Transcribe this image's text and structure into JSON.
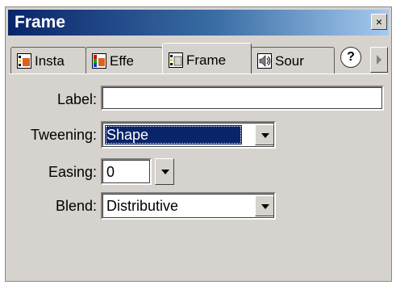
{
  "window": {
    "title": "Frame",
    "close_glyph": "×"
  },
  "tabs": [
    {
      "label": "Insta",
      "icon": "instance-icon"
    },
    {
      "label": "Effe",
      "icon": "effect-icon"
    },
    {
      "label": "Frame",
      "icon": "frame-icon",
      "active": true
    },
    {
      "label": "Sour",
      "icon": "sound-icon"
    }
  ],
  "help": {
    "glyph": "?"
  },
  "form": {
    "label": {
      "caption": "Label:",
      "value": ""
    },
    "tweening": {
      "caption": "Tweening:",
      "value": "Shape"
    },
    "easing": {
      "caption": "Easing:",
      "value": "0"
    },
    "blend": {
      "caption": "Blend:",
      "value": "Distributive"
    }
  },
  "colors": {
    "title_start": "#0a246a",
    "title_end": "#a6caf0",
    "selection": "#0a246a",
    "panel": "#d6d3ce"
  }
}
